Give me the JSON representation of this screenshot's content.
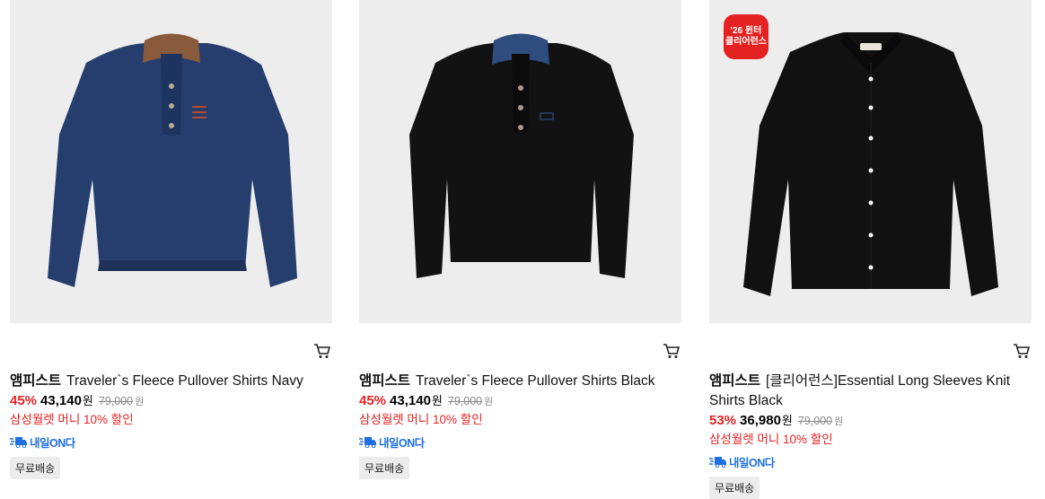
{
  "products": [
    {
      "brand": "앰피스트",
      "name": "Traveler`s Fleece Pullover Shirts Navy",
      "discount": "45%",
      "price": "43,140",
      "currency": "원",
      "original_price": "79,000",
      "original_currency": "원",
      "promo": "삼성월렛 머니 10% 할인",
      "delivery_label": "내일ON다",
      "shipping": "무료배송",
      "image_icon": "navy-pullover-image",
      "color": "#263e6e"
    },
    {
      "brand": "앰피스트",
      "name": "Traveler`s Fleece Pullover Shirts Black",
      "discount": "45%",
      "price": "43,140",
      "currency": "원",
      "original_price": "79,000",
      "original_currency": "원",
      "promo": "삼성월렛 머니 10% 할인",
      "delivery_label": "내일ON다",
      "shipping": "무료배송",
      "image_icon": "black-pullover-image",
      "color": "#121212"
    },
    {
      "brand": "앰피스트",
      "name": "[클리어런스]Essential Long Sleeves Knit Shirts Black",
      "discount": "53%",
      "price": "36,980",
      "currency": "원",
      "original_price": "79,000",
      "original_currency": "원",
      "promo": "삼성월렛 머니 10% 할인",
      "delivery_label": "내일ON다",
      "shipping": "무료배송",
      "badge_line1": "'26 윈터",
      "badge_line2": "클리어런스",
      "image_icon": "black-knit-shirt-image",
      "color": "#111111"
    }
  ],
  "colors": {
    "discount_red": "#e52222",
    "delivery_blue": "#1f6fe0",
    "image_bg": "#ededed"
  },
  "icons": {
    "cart": "cart-icon",
    "truck": "delivery-truck-icon"
  }
}
